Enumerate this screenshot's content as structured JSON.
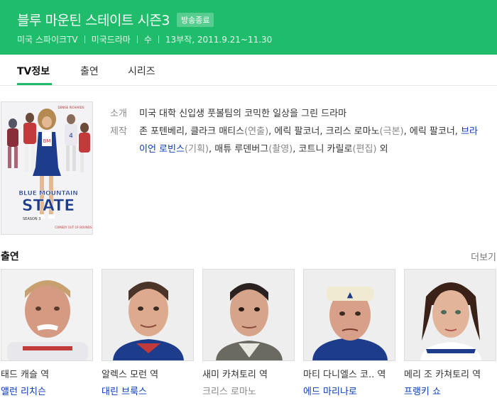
{
  "header": {
    "title": "블루 마운틴 스테이트 시즌3",
    "status_badge": "방송종료",
    "meta": [
      "미국 스파이크TV",
      "미국드라마",
      "수",
      "13부작, 2011.9.21~11.30"
    ]
  },
  "tabs": [
    {
      "label": "TV정보",
      "active": true
    },
    {
      "label": "출연",
      "active": false
    },
    {
      "label": "시리즈",
      "active": false
    }
  ],
  "poster": {
    "top_text": "DENISE RICHARDS",
    "title_line1": "BLUE MOUNTAIN",
    "title_line2": "STATE",
    "season": "SEASON 3",
    "tagline": "COMEDY OUT OF BOUNDS."
  },
  "info": {
    "intro_label": "소개",
    "intro_text": "미국 대학 신입생 풋볼팀의 코믹한 일상을 그린 드라마",
    "production_label": "제작",
    "production_parts": [
      {
        "text": "존 포텐베리, 클라크 매티스",
        "hl": false,
        "paren": false
      },
      {
        "text": "(연출)",
        "hl": false,
        "paren": true
      },
      {
        "text": ", 에릭 팔코너, 크리스 로마노",
        "hl": false,
        "paren": false
      },
      {
        "text": "(극본)",
        "hl": false,
        "paren": true
      },
      {
        "text": ", 에릭 팔코너, ",
        "hl": false,
        "paren": false
      },
      {
        "text": "브라이언 로빈스",
        "hl": true,
        "paren": false
      },
      {
        "text": "(기획)",
        "hl": false,
        "paren": true
      },
      {
        "text": ", 매튜 루덴버그",
        "hl": false,
        "paren": false
      },
      {
        "text": "(촬영)",
        "hl": false,
        "paren": true
      },
      {
        "text": ", 코트니 카릴로",
        "hl": false,
        "paren": false
      },
      {
        "text": "(편집)",
        "hl": false,
        "paren": true
      },
      {
        "text": " 외",
        "hl": false,
        "paren": false
      }
    ]
  },
  "cast_section": {
    "title": "출연",
    "more_label": "더보기"
  },
  "cast": [
    {
      "role": "태드 캐슬 역",
      "actor": "앨런 리치슨",
      "linked": true
    },
    {
      "role": "알렉스 모런 역",
      "actor": "대린 브룩스",
      "linked": true
    },
    {
      "role": "새미 카쳐토리 역",
      "actor": "크리스 로마노",
      "linked": false
    },
    {
      "role": "마티 다니엘스 코.. 역",
      "actor": "에드 마리나로",
      "linked": true
    },
    {
      "role": "메리 조 카쳐토리 역",
      "actor": "프랭키 쇼",
      "linked": true
    }
  ],
  "colors": {
    "accent": "#1fbc6b",
    "link": "#0a3bb5"
  }
}
